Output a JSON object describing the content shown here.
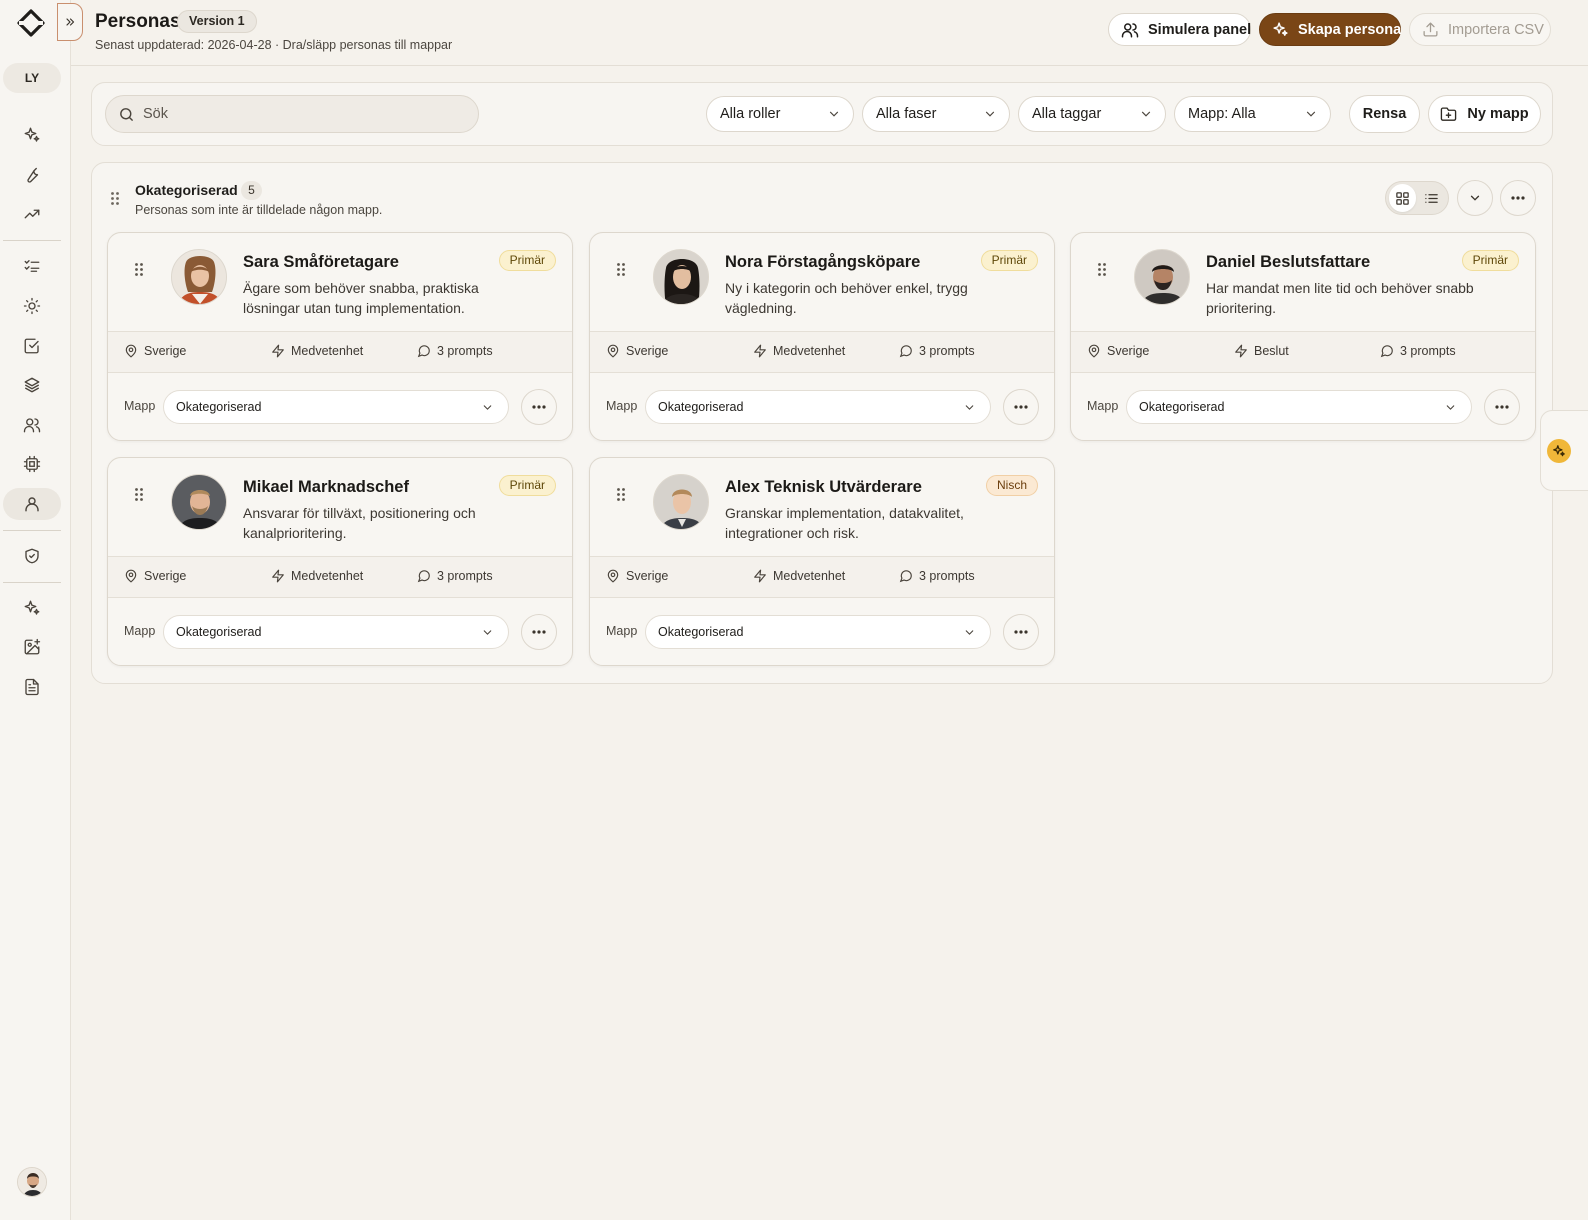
{
  "app": {
    "workspace_initials": "LY"
  },
  "header": {
    "title": "Personas",
    "version": "Version 1",
    "subtitle": "Senast uppdaterad: 2026-04-28 · Dra/släpp personas till mappar",
    "simulate_label": "Simulera panel",
    "create_label": "Skapa persona",
    "import_label": "Importera CSV"
  },
  "filters": {
    "search_placeholder": "Sök",
    "search_value": "",
    "roles": "Alla roller",
    "phases": "Alla faser",
    "tags": "Alla taggar",
    "folder": "Mapp: Alla",
    "clear_label": "Rensa",
    "new_folder_label": "Ny mapp"
  },
  "group": {
    "title": "Okategoriserad",
    "count": "5",
    "description": "Personas som inte är tilldelade någon mapp.",
    "view_mode": "grid"
  },
  "cards": [
    {
      "name": "Sara Småföretagare",
      "description": "Ägare som behöver snabba, praktiska lösningar utan tung implementation.",
      "tier": "Primär",
      "tier_type": "primary",
      "location": "Sverige",
      "phase": "Medvetenhet",
      "prompts": "3 prompts",
      "folder_label": "Mapp",
      "folder_value": "Okategoriserad"
    },
    {
      "name": "Nora Förstagångsköpare",
      "description": "Ny i kategorin och behöver enkel, trygg vägledning.",
      "tier": "Primär",
      "tier_type": "primary",
      "location": "Sverige",
      "phase": "Medvetenhet",
      "prompts": "3 prompts",
      "folder_label": "Mapp",
      "folder_value": "Okategoriserad"
    },
    {
      "name": "Daniel Beslutsfattare",
      "description": "Har mandat men lite tid och behöver snabb prioritering.",
      "tier": "Primär",
      "tier_type": "primary",
      "location": "Sverige",
      "phase": "Beslut",
      "prompts": "3 prompts",
      "folder_label": "Mapp",
      "folder_value": "Okategoriserad"
    },
    {
      "name": "Mikael Marknadschef",
      "description": "Ansvarar för tillväxt, positionering och kanalprioritering.",
      "tier": "Primär",
      "tier_type": "primary",
      "location": "Sverige",
      "phase": "Medvetenhet",
      "prompts": "3 prompts",
      "folder_label": "Mapp",
      "folder_value": "Okategoriserad"
    },
    {
      "name": "Alex Teknisk Utvärderare",
      "description": "Granskar implementation, datakvalitet, integrationer och risk.",
      "tier": "Nisch",
      "tier_type": "niche",
      "location": "Sverige",
      "phase": "Medvetenhet",
      "prompts": "3 prompts",
      "folder_label": "Mapp",
      "folder_value": "Okategoriserad"
    }
  ],
  "icons": {
    "sidebar": [
      "sparkles-icon",
      "wrench-icon",
      "trending-up-icon",
      "list-checks-icon",
      "sun-icon",
      "check-square-icon",
      "layers-icon",
      "users-icon",
      "cpu-icon",
      "user-icon",
      "shield-check-icon",
      "sparkles-icon",
      "image-plus-icon",
      "file-text-icon"
    ],
    "assistant": "sparkles-icon"
  },
  "colors": {
    "accent": "#7a4616",
    "background": "#f5f2ec",
    "primary_badge": "#fbf1cf",
    "niche_badge": "#fbe9d3",
    "assistant": "#f0b739"
  }
}
